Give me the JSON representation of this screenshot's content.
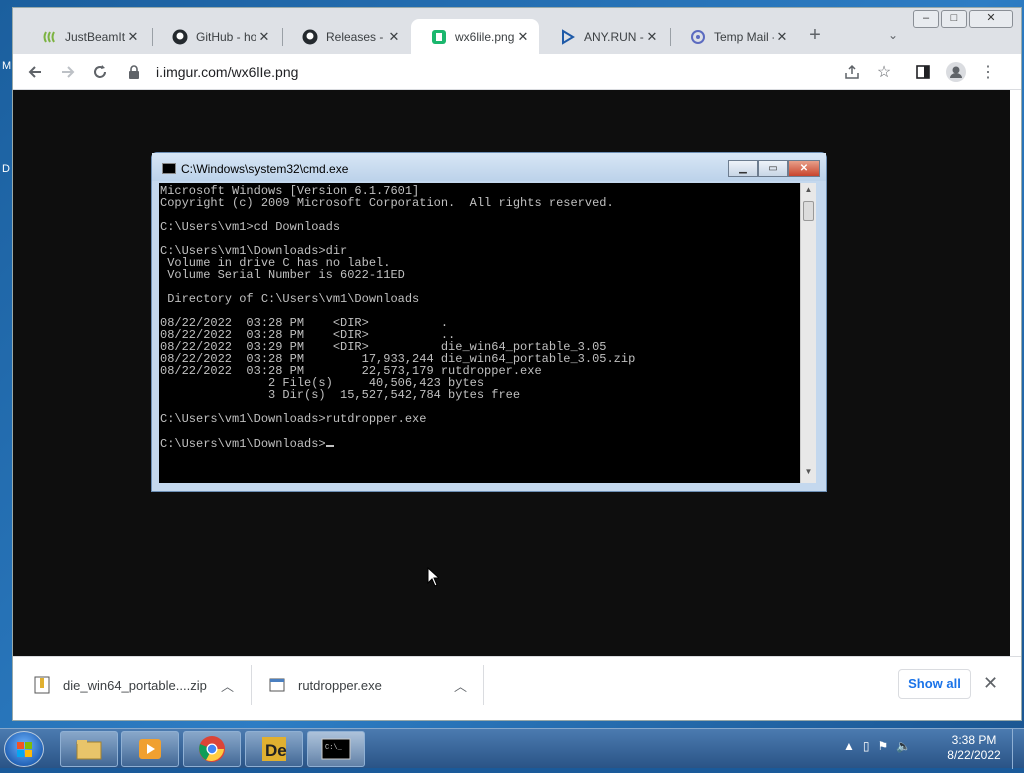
{
  "desktop": {
    "left_labels": [
      "M",
      "D"
    ]
  },
  "browser": {
    "tabs": [
      {
        "title": "JustBeamIt",
        "icon": "justbeamit-icon",
        "active": false
      },
      {
        "title": "GitHub - ho",
        "icon": "github-icon",
        "active": false
      },
      {
        "title": "Releases - h",
        "icon": "github-icon",
        "active": false
      },
      {
        "title": "wx6lile.png",
        "icon": "imgur-icon",
        "active": true
      },
      {
        "title": "ANY.RUN -",
        "icon": "anyrun-icon",
        "active": false
      },
      {
        "title": "Temp Mail -",
        "icon": "tempmail-icon",
        "active": false
      }
    ],
    "new_tab": "+",
    "url": "i.imgur.com/wx6lIe.png",
    "window_buttons": [
      "–",
      "□",
      "✕"
    ]
  },
  "cmd": {
    "title": "C:\\Windows\\system32\\cmd.exe",
    "lines": [
      "Microsoft Windows [Version 6.1.7601]",
      "Copyright (c) 2009 Microsoft Corporation.  All rights reserved.",
      "",
      "C:\\Users\\vm1>cd Downloads",
      "",
      "C:\\Users\\vm1\\Downloads>dir",
      " Volume in drive C has no label.",
      " Volume Serial Number is 6022-11ED",
      "",
      " Directory of C:\\Users\\vm1\\Downloads",
      "",
      "08/22/2022  03:28 PM    <DIR>          .",
      "08/22/2022  03:28 PM    <DIR>          ..",
      "08/22/2022  03:29 PM    <DIR>          die_win64_portable_3.05",
      "08/22/2022  03:28 PM        17,933,244 die_win64_portable_3.05.zip",
      "08/22/2022  03:28 PM        22,573,179 rutdropper.exe",
      "               2 File(s)     40,506,423 bytes",
      "               3 Dir(s)  15,527,542,784 bytes free",
      "",
      "C:\\Users\\vm1\\Downloads>rutdropper.exe",
      ""
    ],
    "prompt": "C:\\Users\\vm1\\Downloads>"
  },
  "downloads": {
    "items": [
      {
        "name": "die_win64_portable....zip",
        "icon": "zip-file-icon"
      },
      {
        "name": "rutdropper.exe",
        "icon": "exe-file-icon"
      }
    ],
    "show_all": "Show all"
  },
  "taskbar": {
    "apps": [
      "explorer",
      "media-player",
      "chrome",
      "detect-it-easy",
      "cmd"
    ],
    "time": "3:38 PM",
    "date": "8/22/2022"
  }
}
